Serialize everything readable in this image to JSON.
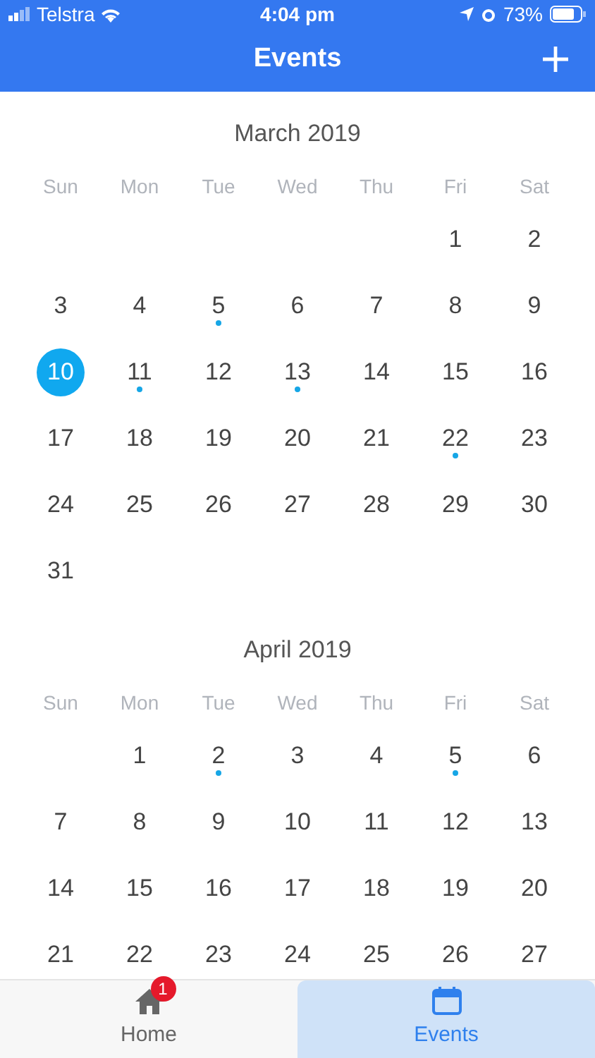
{
  "status_bar": {
    "carrier": "Telstra",
    "time": "4:04 pm",
    "battery": "73%"
  },
  "header": {
    "title": "Events"
  },
  "months": [
    {
      "title": "March 2019",
      "weekdays": [
        "Sun",
        "Mon",
        "Tue",
        "Wed",
        "Thu",
        "Fri",
        "Sat"
      ],
      "weeks": [
        {
          "kind": "first",
          "days": [
            {
              "day": "1",
              "selected": false,
              "has_event": false
            },
            {
              "day": "2",
              "selected": false,
              "has_event": false
            }
          ]
        },
        {
          "kind": "middle",
          "days": [
            {
              "day": "3",
              "selected": false,
              "has_event": false
            },
            {
              "day": "4",
              "selected": false,
              "has_event": false
            },
            {
              "day": "5",
              "selected": false,
              "has_event": true
            },
            {
              "day": "6",
              "selected": false,
              "has_event": false
            },
            {
              "day": "7",
              "selected": false,
              "has_event": false
            },
            {
              "day": "8",
              "selected": false,
              "has_event": false
            },
            {
              "day": "9",
              "selected": false,
              "has_event": false
            }
          ]
        },
        {
          "kind": "middle",
          "days": [
            {
              "day": "10",
              "selected": true,
              "has_event": false
            },
            {
              "day": "11",
              "selected": false,
              "has_event": true
            },
            {
              "day": "12",
              "selected": false,
              "has_event": false
            },
            {
              "day": "13",
              "selected": false,
              "has_event": true
            },
            {
              "day": "14",
              "selected": false,
              "has_event": false
            },
            {
              "day": "15",
              "selected": false,
              "has_event": false
            },
            {
              "day": "16",
              "selected": false,
              "has_event": false
            }
          ]
        },
        {
          "kind": "middle",
          "days": [
            {
              "day": "17",
              "selected": false,
              "has_event": false
            },
            {
              "day": "18",
              "selected": false,
              "has_event": false
            },
            {
              "day": "19",
              "selected": false,
              "has_event": false
            },
            {
              "day": "20",
              "selected": false,
              "has_event": false
            },
            {
              "day": "21",
              "selected": false,
              "has_event": false
            },
            {
              "day": "22",
              "selected": false,
              "has_event": true
            },
            {
              "day": "23",
              "selected": false,
              "has_event": false
            }
          ]
        },
        {
          "kind": "middle",
          "days": [
            {
              "day": "24",
              "selected": false,
              "has_event": false
            },
            {
              "day": "25",
              "selected": false,
              "has_event": false
            },
            {
              "day": "26",
              "selected": false,
              "has_event": false
            },
            {
              "day": "27",
              "selected": false,
              "has_event": false
            },
            {
              "day": "28",
              "selected": false,
              "has_event": false
            },
            {
              "day": "29",
              "selected": false,
              "has_event": false
            },
            {
              "day": "30",
              "selected": false,
              "has_event": false
            }
          ]
        },
        {
          "kind": "last",
          "days": [
            {
              "day": "31",
              "selected": false,
              "has_event": false
            }
          ]
        }
      ]
    },
    {
      "title": "April 2019",
      "weekdays": [
        "Sun",
        "Mon",
        "Tue",
        "Wed",
        "Thu",
        "Fri",
        "Sat"
      ],
      "weeks": [
        {
          "kind": "first",
          "days": [
            {
              "day": "1",
              "selected": false,
              "has_event": false
            },
            {
              "day": "2",
              "selected": false,
              "has_event": true
            },
            {
              "day": "3",
              "selected": false,
              "has_event": false
            },
            {
              "day": "4",
              "selected": false,
              "has_event": false
            },
            {
              "day": "5",
              "selected": false,
              "has_event": true
            },
            {
              "day": "6",
              "selected": false,
              "has_event": false
            }
          ]
        },
        {
          "kind": "middle",
          "days": [
            {
              "day": "7",
              "selected": false,
              "has_event": false
            },
            {
              "day": "8",
              "selected": false,
              "has_event": false
            },
            {
              "day": "9",
              "selected": false,
              "has_event": false
            },
            {
              "day": "10",
              "selected": false,
              "has_event": false
            },
            {
              "day": "11",
              "selected": false,
              "has_event": false
            },
            {
              "day": "12",
              "selected": false,
              "has_event": false
            },
            {
              "day": "13",
              "selected": false,
              "has_event": false
            }
          ]
        },
        {
          "kind": "middle",
          "days": [
            {
              "day": "14",
              "selected": false,
              "has_event": false
            },
            {
              "day": "15",
              "selected": false,
              "has_event": false
            },
            {
              "day": "16",
              "selected": false,
              "has_event": false
            },
            {
              "day": "17",
              "selected": false,
              "has_event": false
            },
            {
              "day": "18",
              "selected": false,
              "has_event": false
            },
            {
              "day": "19",
              "selected": false,
              "has_event": false
            },
            {
              "day": "20",
              "selected": false,
              "has_event": false
            }
          ]
        },
        {
          "kind": "middle",
          "days": [
            {
              "day": "21",
              "selected": false,
              "has_event": false
            },
            {
              "day": "22",
              "selected": false,
              "has_event": false
            },
            {
              "day": "23",
              "selected": false,
              "has_event": false
            },
            {
              "day": "24",
              "selected": false,
              "has_event": false
            },
            {
              "day": "25",
              "selected": false,
              "has_event": false
            },
            {
              "day": "26",
              "selected": false,
              "has_event": false
            },
            {
              "day": "27",
              "selected": false,
              "has_event": false
            }
          ]
        }
      ]
    }
  ],
  "tab_bar": [
    {
      "kind": "home",
      "label": "Home",
      "badge": "1",
      "selected": false
    },
    {
      "kind": "events",
      "label": "Events",
      "selected": true
    }
  ]
}
